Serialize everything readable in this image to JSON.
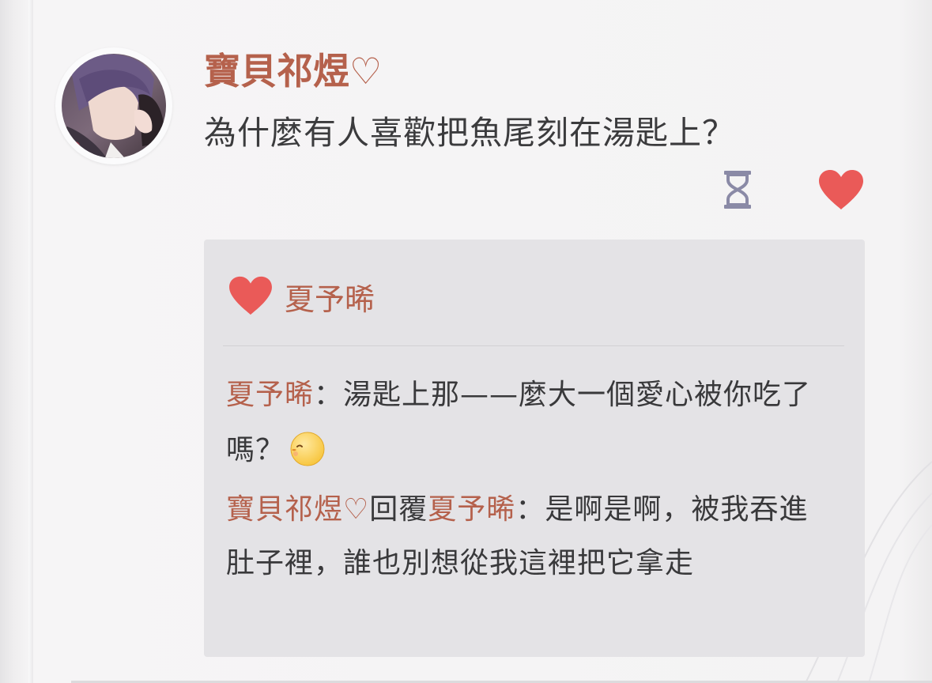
{
  "post": {
    "author": "寶貝祁煜♡",
    "text": "為什麼有人喜歡把魚尾刻在湯匙上？"
  },
  "actions": {
    "pending_icon": "hourglass-icon",
    "like_icon": "heart-icon",
    "like_color": "#ea5a58"
  },
  "likes": {
    "icon": "heart-icon",
    "names": "夏予晞"
  },
  "comments": [
    {
      "author": "夏予晞",
      "separator": "：",
      "text": "湯匙上那——麼大一個愛心被你吃了嗎？",
      "emoji": "kissing-face-emoji"
    },
    {
      "author": "寶貝祁煜♡",
      "reply_word": "回覆",
      "reply_to": "夏予晞",
      "separator": "：",
      "text": "是啊是啊，被我吞進肚子裡，誰也別想從我這裡把它拿走"
    }
  ],
  "colors": {
    "name": "#b5614c",
    "text": "#3b3b3d",
    "comment_bg": "#e4e3e6",
    "heart": "#ea5a58"
  }
}
